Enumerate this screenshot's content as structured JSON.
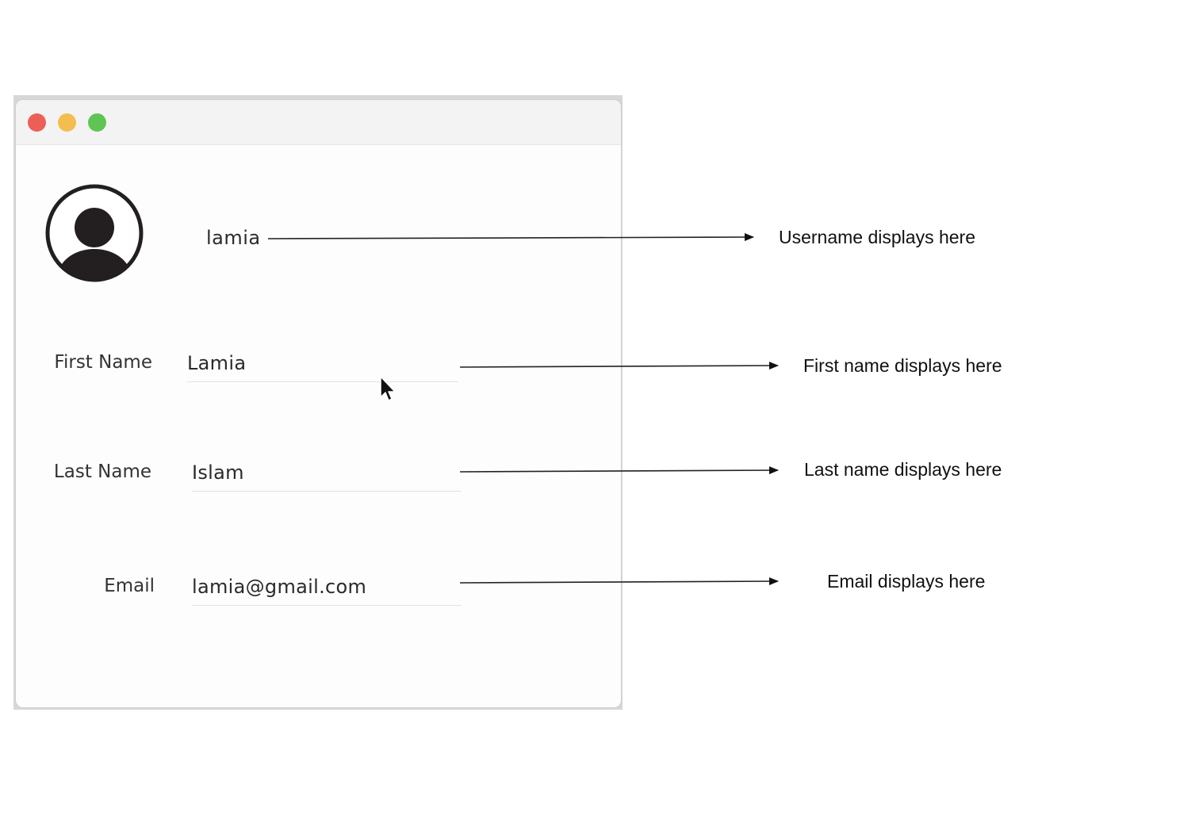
{
  "window": {
    "traffic_lights": {
      "close": "#ec5f57",
      "minimize": "#f3bd4f",
      "zoom": "#5fc454"
    }
  },
  "profile": {
    "avatar_icon": "user-circle-icon",
    "username": "lamia",
    "fields": [
      {
        "label": "First Name",
        "value": "Lamia"
      },
      {
        "label": "Last Name",
        "value": "Islam"
      },
      {
        "label": "Email",
        "value": "lamia@gmail.com"
      }
    ]
  },
  "annotations": [
    {
      "text": "Username displays here"
    },
    {
      "text": "First name displays here"
    },
    {
      "text": "Last name displays here"
    },
    {
      "text": "Email displays here"
    }
  ]
}
